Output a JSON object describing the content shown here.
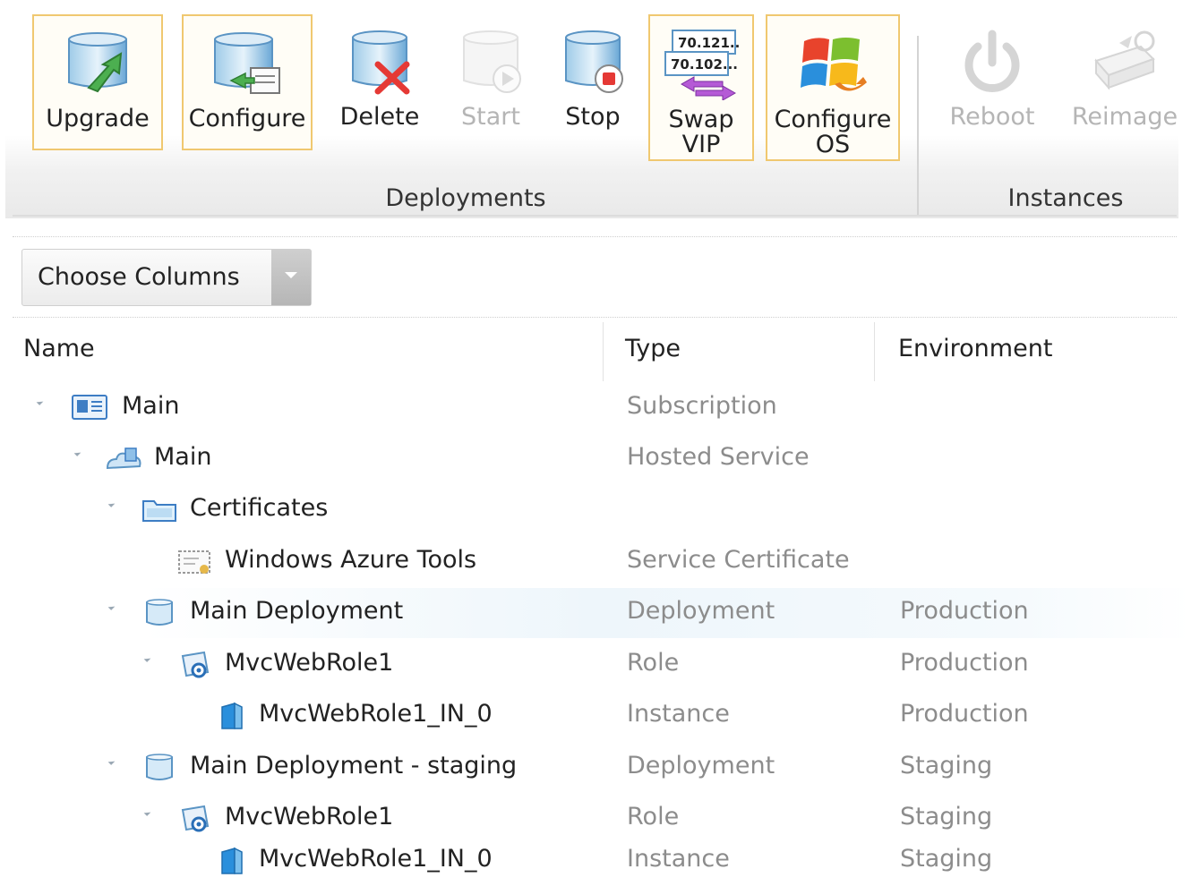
{
  "ribbon": {
    "groups": {
      "deployments": "Deployments",
      "instances": "Instances"
    },
    "buttons": {
      "upgrade": "Upgrade",
      "configure": "Configure",
      "delete": "Delete",
      "start": "Start",
      "stop": "Stop",
      "swap_vip": "Swap\nVIP",
      "swap_vip_ip1": "70.121...",
      "swap_vip_ip2": "70.102...",
      "configure_os": "Configure\nOS",
      "reboot": "Reboot",
      "reimage": "Reimage"
    }
  },
  "toolbar": {
    "choose_columns": "Choose Columns"
  },
  "grid": {
    "columns": {
      "name": "Name",
      "type": "Type",
      "environment": "Environment"
    },
    "rows": [
      {
        "name": "Main",
        "type": "Subscription",
        "environment": "",
        "icon": "subscription-icon"
      },
      {
        "name": "Main",
        "type": "Hosted Service",
        "environment": "",
        "icon": "hosted-service-icon"
      },
      {
        "name": "Certificates",
        "type": "",
        "environment": "",
        "icon": "folder-icon"
      },
      {
        "name": "Windows Azure Tools",
        "type": "Service Certificate",
        "environment": "",
        "icon": "certificate-icon"
      },
      {
        "name": "Main Deployment",
        "type": "Deployment",
        "environment": "Production",
        "icon": "deployment-icon"
      },
      {
        "name": "MvcWebRole1",
        "type": "Role",
        "environment": "Production",
        "icon": "role-icon"
      },
      {
        "name": "MvcWebRole1_IN_0",
        "type": "Instance",
        "environment": "Production",
        "icon": "instance-icon"
      },
      {
        "name": "Main Deployment - staging",
        "type": "Deployment",
        "environment": "Staging",
        "icon": "deployment-icon"
      },
      {
        "name": "MvcWebRole1",
        "type": "Role",
        "environment": "Staging",
        "icon": "role-icon"
      },
      {
        "name": "MvcWebRole1_IN_0",
        "type": "Instance",
        "environment": "Staging",
        "icon": "instance-icon"
      }
    ]
  },
  "colors": {
    "frame": "#f0c870",
    "muted_text": "#8c8c8c",
    "disabled_text": "#b5b5b5"
  }
}
